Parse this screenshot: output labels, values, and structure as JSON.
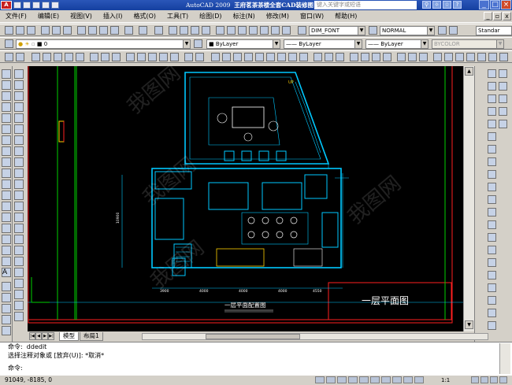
{
  "titlebar": {
    "app_name": "AutoCAD 2009",
    "document": "王府茗茶茶楼全套CAD装修图",
    "search_placeholder": "键入关键字或短语",
    "app_menu_glyph": "A"
  },
  "menu": {
    "items": [
      "文件(F)",
      "编辑(E)",
      "视图(V)",
      "插入(I)",
      "格式(O)",
      "工具(T)",
      "绘图(D)",
      "标注(N)",
      "修改(M)",
      "窗口(W)",
      "帮助(H)"
    ],
    "window_buttons": [
      "_",
      "▫",
      "x"
    ]
  },
  "toolbar1": {
    "textstyle": "DIM_FONT",
    "dimstyle": "NORMAL",
    "tablestyle": "Standar"
  },
  "toolbar2": {
    "layer_name": "0",
    "color": "ByLayer",
    "linetype": "ByLayer",
    "lineweight": "ByLayer",
    "plotstyle": "BYCOLOR"
  },
  "canvas": {
    "drawing_title": "一层平面图",
    "layout_caption": "一层平面配置图",
    "dims": [
      "3900",
      "4000",
      "4000",
      "4000",
      "4550"
    ],
    "side_dim": "10900",
    "watermark": "我图网"
  },
  "tabs": [
    "模型",
    "布局1"
  ],
  "command": {
    "line1_prompt": "命令:",
    "line1_text": "ddedit",
    "line2": "选择注释对象或 [放弃(U)]: *取消*",
    "line3_prompt": "命令:"
  },
  "status": {
    "coordinates": "91049, -8185, 0",
    "annotation_scale": "1:1"
  },
  "colors": {
    "titlebar": "#1a48a8",
    "canvas_bg": "#000000",
    "wall": "#00c8ff",
    "frame": "#ff2020",
    "furniture": "#ffffff",
    "accent_yellow": "#ffd000",
    "accent_green": "#00d000"
  }
}
